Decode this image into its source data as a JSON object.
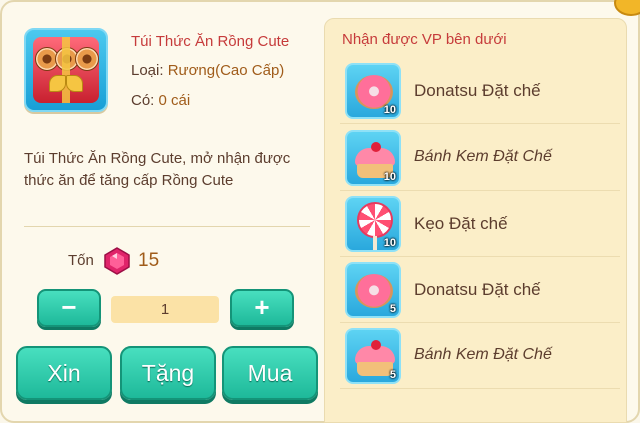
{
  "item": {
    "name": "Túi Thức Ăn Rồng Cute",
    "type_label": "Loại:",
    "type_value": "Rương(Cao Cấp)",
    "count_label": "Có:",
    "count_value": "0 cái",
    "icon": "treasure-box-icon",
    "description": "Túi Thức Ăn Rồng Cute, mở nhận được thức ăn để tăng cấp Rồng Cute"
  },
  "cost": {
    "label": "Tốn",
    "value": "15",
    "icon": "gem-icon"
  },
  "quantity": {
    "minus_label": "−",
    "value": "1",
    "plus_label": "+"
  },
  "actions": {
    "xin_label": "Xin",
    "tang_label": "Tặng",
    "mua_label": "Mua"
  },
  "rewards": {
    "title": "Nhận được VP bên dưới",
    "items": [
      {
        "name": "Donatsu Đặt chế",
        "qty": "10",
        "icon": "donut-icon"
      },
      {
        "name": "Bánh Kem Đặt Chế",
        "qty": "10",
        "icon": "cake-icon"
      },
      {
        "name": "Kẹo Đặt chế",
        "qty": "10",
        "icon": "lollipop-icon"
      },
      {
        "name": "Donatsu Đặt chế",
        "qty": "5",
        "icon": "donut-icon"
      },
      {
        "name": "Bánh Kem Đặt Chế",
        "qty": "5",
        "icon": "cake-icon"
      }
    ]
  },
  "colors": {
    "accent_red": "#c63b3b",
    "button_teal": "#1eb99a",
    "panel_bg": "#fdf9ec"
  }
}
